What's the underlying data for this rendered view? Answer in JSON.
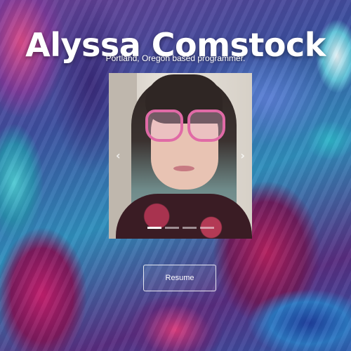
{
  "header": {
    "name": "Alyssa Comstock",
    "tagline": "Portland, Oregon based programmer."
  },
  "carousel": {
    "prev_icon": "chevron-left-icon",
    "next_icon": "chevron-right-icon",
    "prev_glyph": "‹",
    "next_glyph": "›",
    "slide_count": 4,
    "active_index": 0
  },
  "actions": {
    "resume_label": "Resume"
  }
}
